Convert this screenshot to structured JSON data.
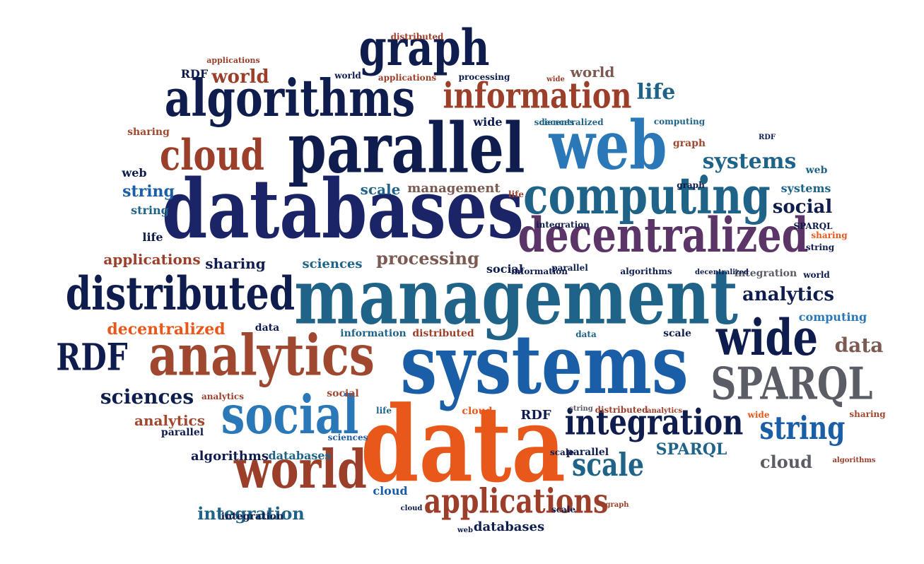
{
  "palette": {
    "navy": "#1a2466",
    "darknavy": "#0e1c4e",
    "blue": "#1b5ea8",
    "teal": "#1f6488",
    "lightblue": "#2a78b8",
    "brown": "#a0482f",
    "rust": "#9b3f2a",
    "orange": "#e8581a",
    "purple": "#5b3567",
    "gray": "#5a5c66",
    "taupe": "#7b5a52"
  },
  "words": [
    {
      "text": "management",
      "c": "teal"
    },
    {
      "text": "systems",
      "c": "blue"
    },
    {
      "text": "data",
      "c": "orange"
    },
    {
      "text": "databases",
      "c": "navy"
    },
    {
      "text": "parallel",
      "c": "darknavy"
    },
    {
      "text": "web",
      "c": "lightblue"
    },
    {
      "text": "analytics",
      "c": "brown"
    },
    {
      "text": "algorithms",
      "c": "darknavy"
    },
    {
      "text": "computing",
      "c": "teal"
    },
    {
      "text": "decentralized",
      "c": "purple"
    },
    {
      "text": "social",
      "c": "lightblue"
    },
    {
      "text": "world",
      "c": "rust"
    },
    {
      "text": "distributed",
      "c": "darknavy"
    },
    {
      "text": "wide",
      "c": "darknavy"
    },
    {
      "text": "SPARQL",
      "c": "gray"
    },
    {
      "text": "graph",
      "c": "darknavy"
    },
    {
      "text": "information",
      "c": "rust"
    },
    {
      "text": "cloud",
      "c": "rust"
    },
    {
      "text": "integration",
      "c": "darknavy"
    },
    {
      "text": "applications",
      "c": "rust"
    },
    {
      "text": "RDF",
      "c": "darknavy"
    },
    {
      "text": "string",
      "c": "blue"
    },
    {
      "text": "scale",
      "c": "teal"
    },
    {
      "text": "systems",
      "c": "teal"
    },
    {
      "text": "social",
      "c": "darknavy"
    },
    {
      "text": "life",
      "c": "teal"
    },
    {
      "text": "data",
      "c": "taupe"
    },
    {
      "text": "sciences",
      "c": "darknavy"
    },
    {
      "text": "analytics",
      "c": "darknavy"
    },
    {
      "text": "processing",
      "c": "taupe"
    },
    {
      "text": "decentralized",
      "c": "orange"
    },
    {
      "text": "cloud",
      "c": "gray"
    },
    {
      "text": "SPARQL",
      "c": "teal"
    },
    {
      "text": "integration",
      "c": "teal"
    },
    {
      "text": "applications",
      "c": "rust"
    },
    {
      "text": "sharing",
      "c": "darknavy"
    },
    {
      "text": "sciences",
      "c": "teal"
    },
    {
      "text": "string",
      "c": "blue"
    },
    {
      "text": "scale",
      "c": "teal"
    },
    {
      "text": "management",
      "c": "taupe"
    },
    {
      "text": "world",
      "c": "rust"
    },
    {
      "text": "world",
      "c": "taupe"
    },
    {
      "text": "analytics",
      "c": "brown"
    },
    {
      "text": "algorithms",
      "c": "darknavy"
    },
    {
      "text": "databases",
      "c": "teal"
    },
    {
      "text": "databases",
      "c": "darknavy"
    },
    {
      "text": "sciences",
      "c": "blue"
    },
    {
      "text": "string",
      "c": "teal"
    },
    {
      "text": "web",
      "c": "teal"
    },
    {
      "text": "social",
      "c": "darknavy"
    },
    {
      "text": "computing",
      "c": "lightblue"
    },
    {
      "text": "information",
      "c": "teal"
    },
    {
      "text": "distributed",
      "c": "rust"
    },
    {
      "text": "integration",
      "c": "gray"
    },
    {
      "text": "sharing",
      "c": "brown"
    },
    {
      "text": "cloud",
      "c": "blue"
    },
    {
      "text": "parallel",
      "c": "darknavy"
    },
    {
      "text": "parallel",
      "c": "darknavy"
    },
    {
      "text": "life",
      "c": "darknavy"
    },
    {
      "text": "data",
      "c": "darknavy"
    },
    {
      "text": "scale",
      "c": "darknavy"
    },
    {
      "text": "decentralized",
      "c": "teal"
    },
    {
      "text": "processing",
      "c": "darknavy"
    },
    {
      "text": "wide",
      "c": "darknavy"
    },
    {
      "text": "sciences",
      "c": "teal"
    },
    {
      "text": "world",
      "c": "darknavy"
    },
    {
      "text": "web",
      "c": "darknavy"
    },
    {
      "text": "systems",
      "c": "teal"
    },
    {
      "text": "analytics",
      "c": "rust"
    },
    {
      "text": "RDF",
      "c": "darknavy"
    },
    {
      "text": "RDF",
      "c": "darknavy"
    },
    {
      "text": "graph",
      "c": "brown"
    },
    {
      "text": "wide",
      "c": "rust"
    },
    {
      "text": "sharing",
      "c": "brown"
    },
    {
      "text": "world",
      "c": "darknavy"
    },
    {
      "text": "distributed",
      "c": "rust"
    },
    {
      "text": "applications",
      "c": "rust"
    },
    {
      "text": "life",
      "c": "rust"
    },
    {
      "text": "cloud",
      "c": "orange"
    },
    {
      "text": "integration",
      "c": "darknavy"
    },
    {
      "text": "scale",
      "c": "darknavy"
    },
    {
      "text": "data",
      "c": "teal"
    },
    {
      "text": "SPARQL",
      "c": "darknavy"
    },
    {
      "text": "string",
      "c": "darknavy"
    },
    {
      "text": "algorithms",
      "c": "darknavy"
    },
    {
      "text": "information",
      "c": "darknavy"
    },
    {
      "text": "social",
      "c": "brown"
    },
    {
      "text": "sharing",
      "c": "orange"
    },
    {
      "text": "graph",
      "c": "darknavy"
    },
    {
      "text": "wide",
      "c": "orange"
    },
    {
      "text": "parallel",
      "c": "darknavy"
    },
    {
      "text": "integration",
      "c": "darknavy"
    },
    {
      "text": "decentralized",
      "c": "darknavy"
    },
    {
      "text": "RDF",
      "c": "darknavy"
    },
    {
      "text": "applications",
      "c": "rust"
    },
    {
      "text": "computing",
      "c": "teal"
    },
    {
      "text": "scale",
      "c": "darknavy"
    },
    {
      "text": "distributed",
      "c": "rust"
    },
    {
      "text": "web",
      "c": "darknavy"
    },
    {
      "text": "life",
      "c": "teal"
    },
    {
      "text": "graph",
      "c": "rust"
    },
    {
      "text": "cloud",
      "c": "darknavy"
    },
    {
      "text": "string",
      "c": "gray"
    },
    {
      "text": "analytics",
      "c": "rust"
    },
    {
      "text": "algorithms",
      "c": "rust"
    }
  ]
}
